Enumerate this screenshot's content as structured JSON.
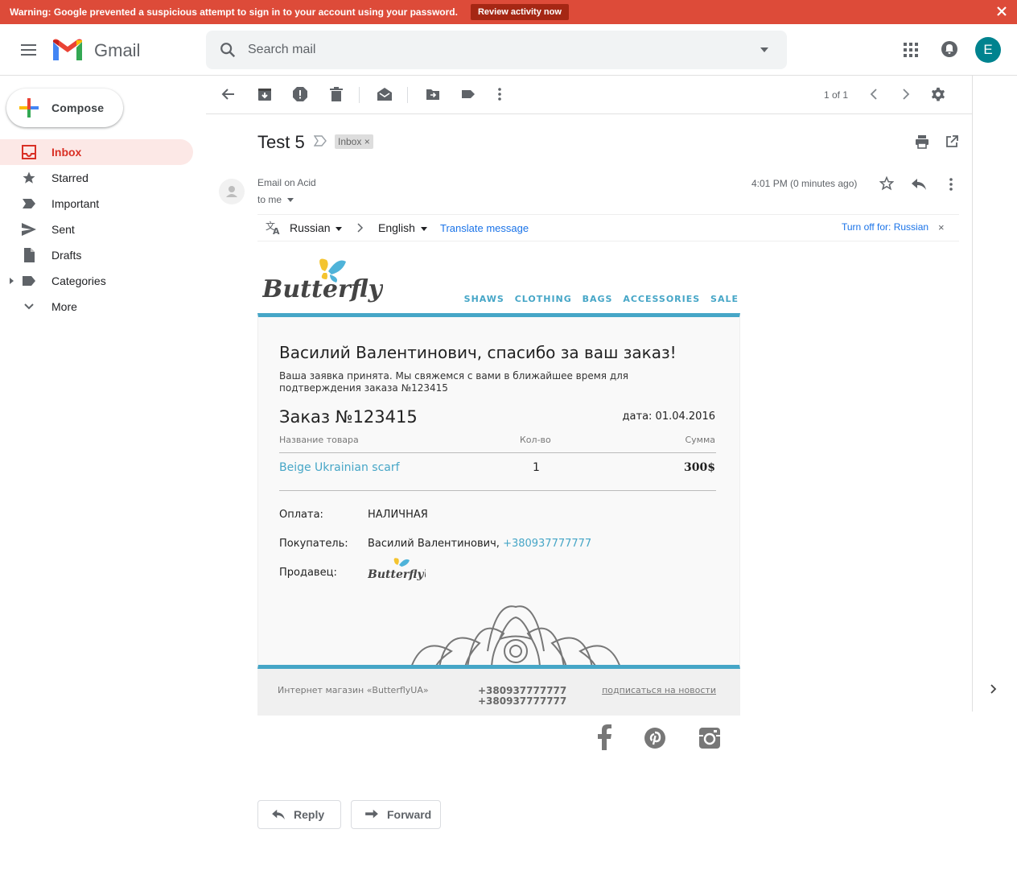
{
  "warning": {
    "text": "Warning: Google prevented a suspicious attempt to sign in to your account using your password.",
    "button": "Review activity now"
  },
  "header": {
    "app_name": "Gmail",
    "search_placeholder": "Search mail",
    "avatar_letter": "E"
  },
  "sidebar": {
    "compose": "Compose",
    "items": [
      {
        "label": "Inbox",
        "icon": "inbox-icon",
        "selected": true
      },
      {
        "label": "Starred",
        "icon": "star-icon"
      },
      {
        "label": "Important",
        "icon": "important-icon"
      },
      {
        "label": "Sent",
        "icon": "send-icon"
      },
      {
        "label": "Drafts",
        "icon": "drafts-icon"
      },
      {
        "label": "Categories",
        "icon": "label-icon"
      },
      {
        "label": "More",
        "icon": "chevron-down-icon"
      }
    ]
  },
  "toolbar": {
    "count": "1 of 1"
  },
  "message": {
    "subject": "Test 5",
    "label": "Inbox",
    "sender": "Email on Acid",
    "to": "to me",
    "time": "4:01 PM (0 minutes ago)"
  },
  "translate": {
    "from": "Russian",
    "to": "English",
    "action": "Translate message",
    "turn_off": "Turn off for: Russian"
  },
  "email": {
    "brand": "ButterflyUA",
    "nav": [
      "SHAWS",
      "CLOTHING",
      "BAGS",
      "ACCESSORIES",
      "SALE"
    ],
    "heading": "Василий Валентинович, спасибо за ваш заказ!",
    "intro": "Ваша заявка принята. Мы свяжемся с вами в ближайшее время для подтверждения заказа №123415",
    "order_title": "Заказ №123415",
    "order_date": "дата: 01.04.2016",
    "col_name": "Название товара",
    "col_qty": "Кол-во",
    "col_sum": "Сумма",
    "item_name": "Beige Ukrainian scarf",
    "item_qty": "1",
    "item_sum": "300$",
    "pay_label": "Оплата:",
    "pay_value": "НАЛИЧНАЯ",
    "buyer_label": "Покупатель:",
    "buyer_name": "Василий Валентинович,",
    "buyer_phone": "+380937777777",
    "seller_label": "Продавец:",
    "footer_shop": "Интернет магазин «ButterflyUA»",
    "footer_phone1": "+380937777777",
    "footer_phone2": "+380937777777",
    "footer_subscribe": "подписаться на новости"
  },
  "actions": {
    "reply": "Reply",
    "forward": "Forward"
  },
  "colors": {
    "warning": "#dd4b39",
    "accent": "#46a6c7",
    "selected_bg": "#fce8e6",
    "selected_fg": "#d93025",
    "avatar": "#00838f"
  }
}
